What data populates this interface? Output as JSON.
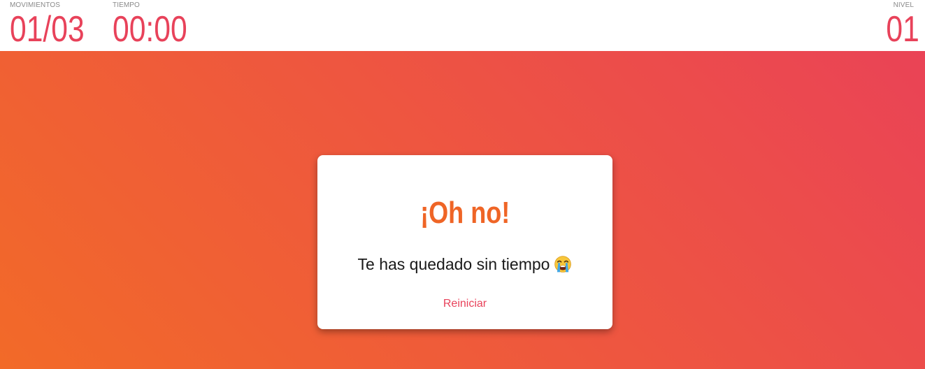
{
  "header": {
    "moves": {
      "label": "MOVIMIENTOS",
      "value": "01/03"
    },
    "time": {
      "label": "TIEMPO",
      "value": "00:00"
    },
    "level": {
      "label": "NIVEL",
      "value": "01"
    }
  },
  "modal": {
    "title": "¡Oh no!",
    "message": "Te has quedado sin tiempo",
    "message_icon": "loudly-crying-face-icon",
    "button_label": "Reiniciar"
  },
  "colors": {
    "accent": "#e8425a",
    "title": "#ef6526",
    "gradient_start": "#f26a28",
    "gradient_end": "#ea4356"
  }
}
